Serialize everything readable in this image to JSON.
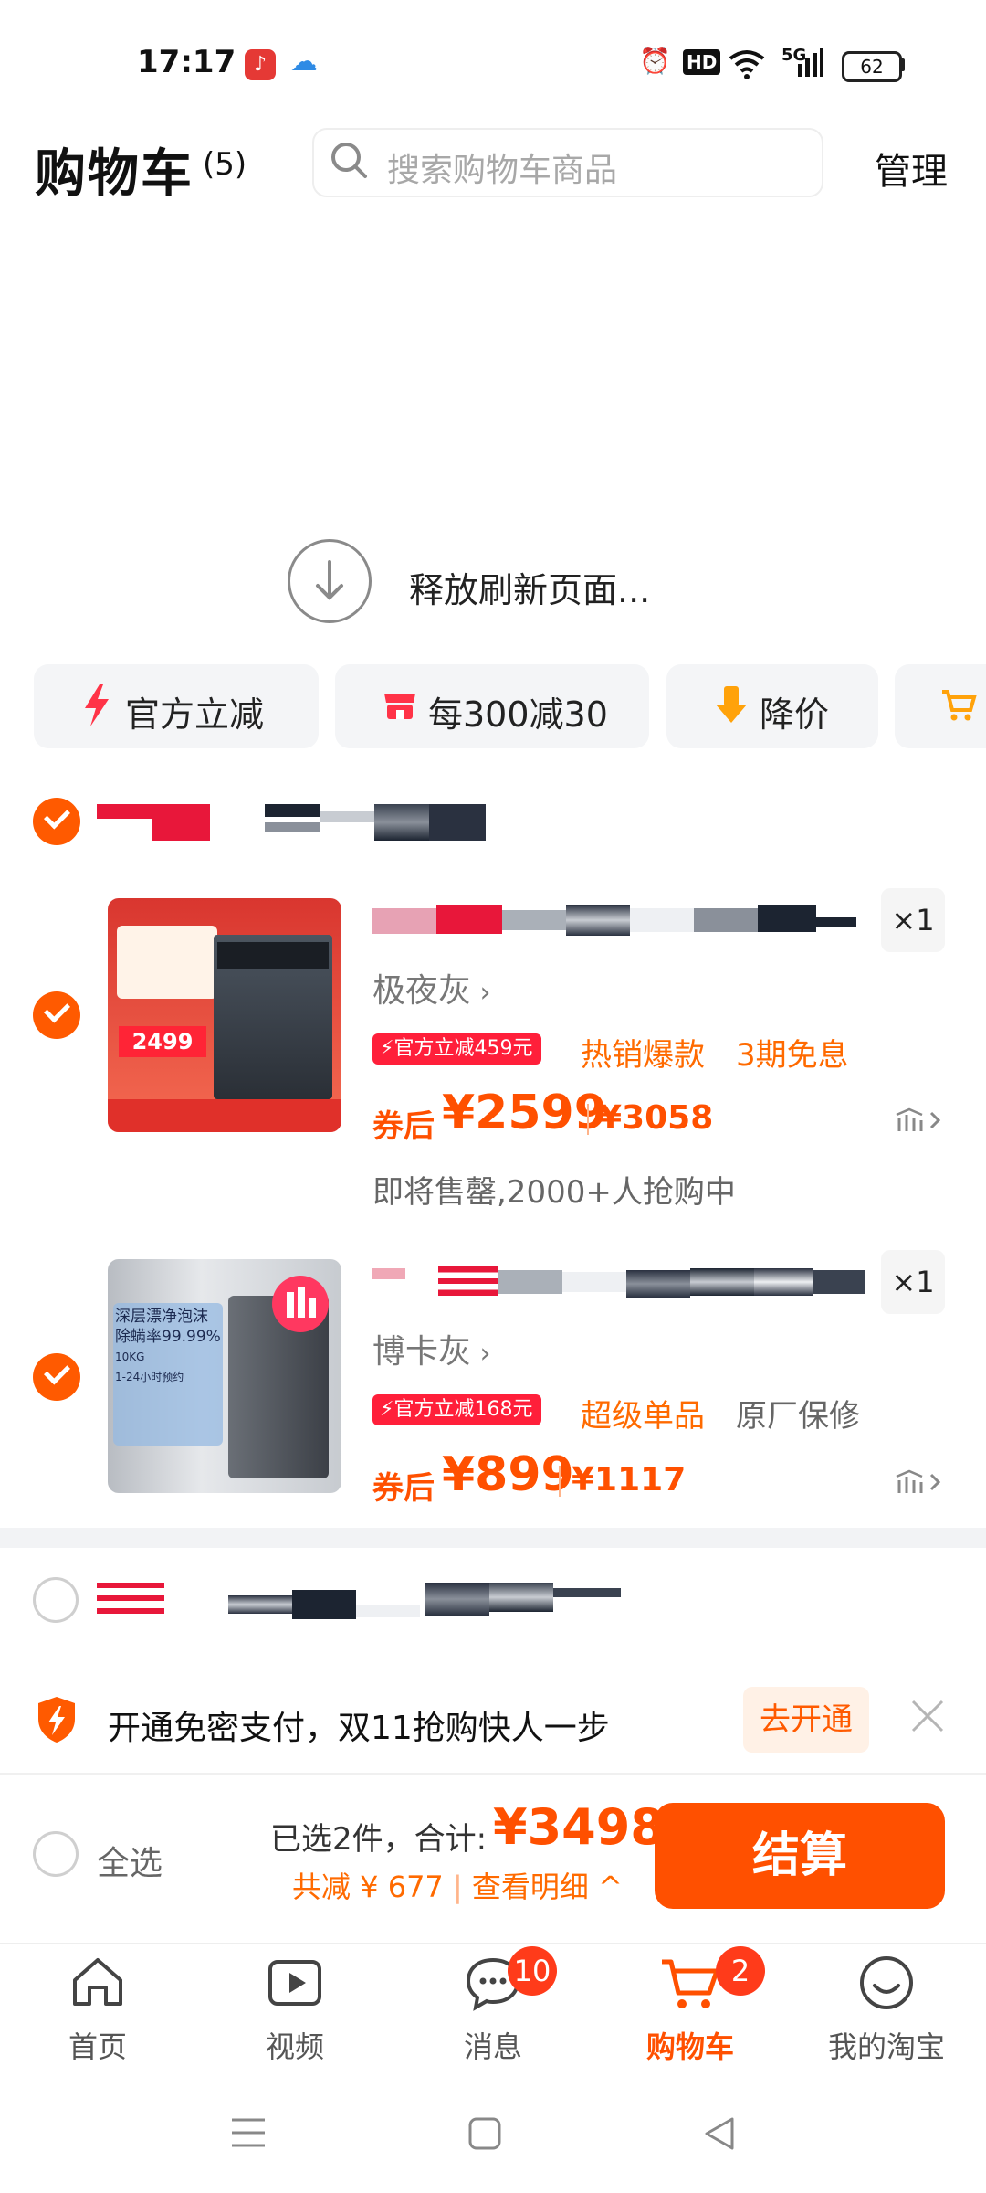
{
  "status_bar": {
    "time": "17:17",
    "signal_label": "5G",
    "hd_label": "HD",
    "battery": "62"
  },
  "header": {
    "title": "购物车",
    "count": "(5)",
    "search_placeholder": "搜索购物车商品",
    "manage": "管理"
  },
  "refresh": {
    "text": "释放刷新页面..."
  },
  "chips": [
    {
      "label": "官方立减",
      "icon": "lightning-icon"
    },
    {
      "label": "每300减30",
      "icon": "store-icon"
    },
    {
      "label": "降价",
      "icon": "arrow-down-icon"
    },
    {
      "label": "",
      "icon": "cart-icon"
    }
  ],
  "items": [
    {
      "quantity": "×1",
      "variant": "极夜灰",
      "badge": "官方立减459元",
      "tags": [
        "热销爆款",
        "3期免息"
      ],
      "price_prefix": "券后",
      "price": "¥2599",
      "original_price": "¥3058",
      "note": "即将售罄,2000+人抢购中",
      "thumb_price": "2499"
    },
    {
      "quantity": "×1",
      "variant": "博卡灰",
      "badge": "官方立减168元",
      "tags": [
        "超级单品",
        "原厂保修"
      ],
      "price_prefix": "券后",
      "price": "¥899",
      "original_price": "¥1117",
      "thumb_text": [
        "深层漂净泡沫",
        "除螨率99.99%",
        "10KG",
        "1-24小时预约"
      ]
    }
  ],
  "banner": {
    "text": "开通免密支付，双11抢购快人一步",
    "button": "去开通"
  },
  "checkout": {
    "select_all": "全选",
    "selected": "已选2件，合计:",
    "total": "¥3498",
    "saving": "共减 ¥ 677",
    "detail": "查看明细",
    "button": "结算"
  },
  "tabs": [
    {
      "label": "首页",
      "icon": "home-icon"
    },
    {
      "label": "视频",
      "icon": "video-icon"
    },
    {
      "label": "消息",
      "icon": "message-icon",
      "badge": "10"
    },
    {
      "label": "购物车",
      "icon": "cart-icon",
      "badge": "2",
      "active": true
    },
    {
      "label": "我的淘宝",
      "icon": "profile-icon"
    }
  ],
  "colors": {
    "accent": "#ff5000",
    "badge_red": "#ff1f3a",
    "chip_bg": "#f4f5f7"
  }
}
